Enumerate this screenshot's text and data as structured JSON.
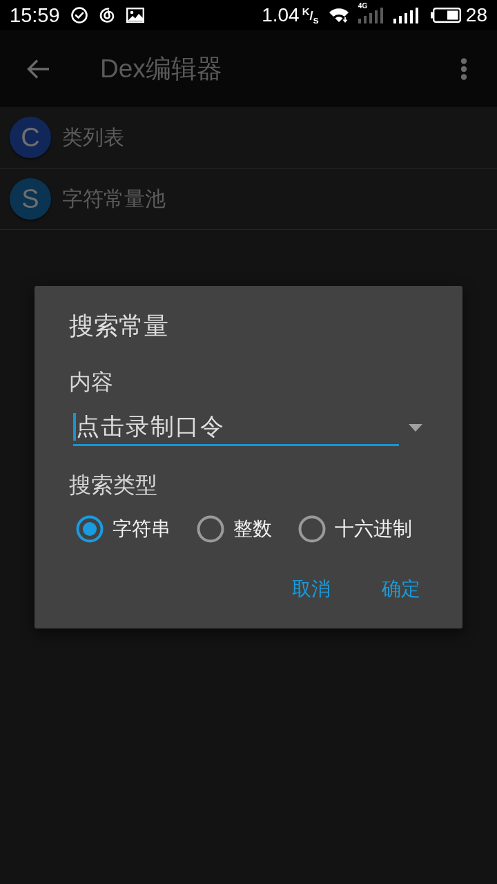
{
  "status_bar": {
    "time": "15:59",
    "speed": "1.04",
    "speed_unit": "$^{K}$/$_{s}$",
    "network_type": "4G",
    "battery": "28"
  },
  "app_bar": {
    "title": "Dex编辑器"
  },
  "list": [
    {
      "letter": "C",
      "label": "类列表",
      "color": "#11275a"
    },
    {
      "letter": "S",
      "label": "字符常量池",
      "color": "#0b3452"
    }
  ],
  "dialog": {
    "title": "搜索常量",
    "content_label": "内容",
    "content_field": {
      "value": "点击录制口令",
      "focused": true
    },
    "type_label": "搜索类型",
    "options": [
      {
        "label": "字符串",
        "selected": true
      },
      {
        "label": "整数",
        "selected": false
      },
      {
        "label": "十六进制",
        "selected": false
      }
    ],
    "buttons": [
      "取消",
      "确定"
    ]
  }
}
